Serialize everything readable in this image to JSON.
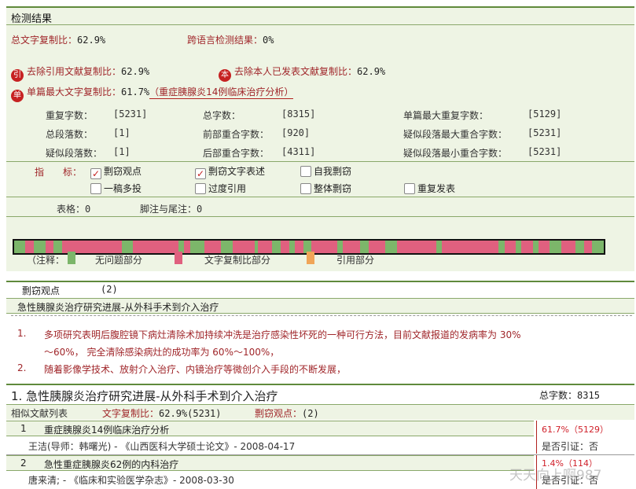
{
  "panel1": {
    "title": "检测结果",
    "total_copy_label": "总文字复制比：",
    "total_copy_value": "62.9%",
    "cross_lang_label": "跨语言检测结果：",
    "cross_lang_value": "0%",
    "excl_ref_icon": "引",
    "excl_ref_label": "去除引用文献复制比：",
    "excl_ref_value": "62.9%",
    "excl_self_icon": "本",
    "excl_self_label": "去除本人已发表文献复制比：",
    "excl_self_value": "62.9%",
    "single_icon": "单",
    "single_max_label": "单篇最大文字复制比：",
    "single_max_value": "61.7%",
    "single_max_title": "（重症胰腺炎14例临床治疗分析）",
    "stats": [
      {
        "label": "重复字数：",
        "value": "[5231]"
      },
      {
        "label": "总字数：",
        "value": "[8315]"
      },
      {
        "label": "单篇最大重复字数：",
        "value": "[5129]"
      },
      {
        "label": "总段落数：",
        "value": "[1]"
      },
      {
        "label": "前部重合字数：",
        "value": "[920]"
      },
      {
        "label": "疑似段落最大重合字数：",
        "value": "[5231]"
      },
      {
        "label": "疑似段落数：",
        "value": "[1]"
      },
      {
        "label": "后部重合字数：",
        "value": "[4311]"
      },
      {
        "label": "疑似段落最小重合字数：",
        "value": "[5231]"
      }
    ],
    "indicator_label": "指　　标：",
    "indicators": [
      {
        "label": "剽窃观点",
        "checked": true
      },
      {
        "label": "剽窃文字表述",
        "checked": true
      },
      {
        "label": "自我剽窃",
        "checked": false
      },
      {
        "label": "一稿多投",
        "checked": false
      },
      {
        "label": "过度引用",
        "checked": false
      },
      {
        "label": "整体剽窃",
        "checked": false
      },
      {
        "label": "重复发表",
        "checked": false
      }
    ],
    "tables_label": "表格：",
    "tables_value": "0",
    "footnote_label": "脚注与尾注：",
    "footnote_value": "0",
    "legend_note": "（注释：",
    "legend": [
      {
        "label": "无问题部分",
        "color": "#7cb66a"
      },
      {
        "label": "文字复制比部分",
        "color": "#e0607f"
      },
      {
        "label": "引用部分",
        "color": "#f0a558"
      }
    ],
    "colors": {
      "green": "#7cb66a",
      "pink": "#e0607f",
      "orange": "#f0a558",
      "accent_red": "#c62222"
    }
  },
  "panel2": {
    "title": "剽窃观点",
    "count": "(2)",
    "doc_title": "急性胰腺炎治疗研究进展-从外科手术到介入治疗",
    "items": [
      {
        "num": "1.",
        "line1": "多项研究表明后腹腔镜下病灶清除术加持续冲洗是治疗感染性坏死的一种可行方法，目前文献报道的发病率为 30%",
        "line2": "～60%， 完全清除感染病灶的成功率为 60%～100%，"
      },
      {
        "num": "2.",
        "line1": "随着影像学技术、放射介入治疗、内镜治疗等微创介入手段的不断发展，"
      }
    ]
  },
  "panel3": {
    "title": "1. 急性胰腺炎治疗研究进展-从外科手术到介入治疗",
    "total_words_label": "总字数：",
    "total_words_value": "8315",
    "sim_list_label": "相似文献列表",
    "copy_ratio_label": "文字复制比：",
    "copy_ratio_value": "62.9%(5231)",
    "plag_label": "剽窃观点：",
    "plag_value": "(2)",
    "docs": [
      {
        "num": "1",
        "title": "重症胰腺炎14例临床治疗分析",
        "author": "王洁(导师：韩曙光) - 《山西医科大学硕士论文》- 2008-04-17",
        "ratio": "61.7%（5129）",
        "cite": "是否引证：否"
      },
      {
        "num": "2",
        "title": "急性重症胰腺炎62例的内科治疗",
        "author": "唐来清; - 《临床和实验医学杂志》- 2008-03-30",
        "ratio": "1.4%（114）",
        "cite": "是否引证：否"
      }
    ]
  },
  "watermark": "天天向上啊987"
}
